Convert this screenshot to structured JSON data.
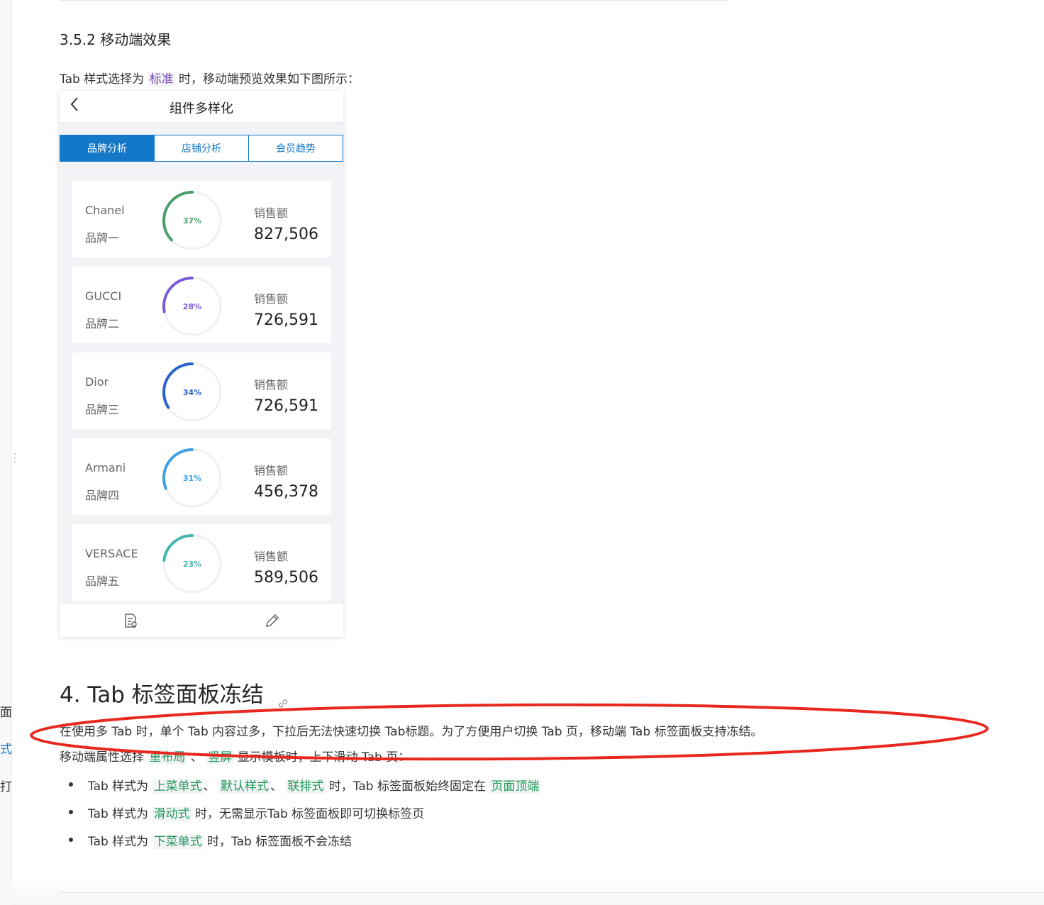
{
  "left_fragments": [
    "面",
    "式",
    "打"
  ],
  "section_352": {
    "title": "3.5.2 移动端效果"
  },
  "intro": {
    "prefix": "Tab 样式选择为 ",
    "tag": "标准",
    "suffix": " 时，移动端预览效果如下图所示："
  },
  "phone": {
    "back_icon": "chevron-left-icon",
    "title": "组件多样化",
    "tabs": [
      {
        "label": "品牌分析",
        "active": true
      },
      {
        "label": "店铺分析",
        "active": false
      },
      {
        "label": "会员趋势",
        "active": false
      }
    ],
    "cards": [
      {
        "brand": "Chanel",
        "name": "品牌一",
        "percent": 37,
        "percent_label": "37%",
        "color": "#4a9f6a",
        "sales_label": "销售额",
        "sales": "827,506"
      },
      {
        "brand": "GUCCI",
        "name": "品牌二",
        "percent": 28,
        "percent_label": "28%",
        "color": "#7a5bd6",
        "sales_label": "销售额",
        "sales": "726,591"
      },
      {
        "brand": "Dior",
        "name": "品牌三",
        "percent": 34,
        "percent_label": "34%",
        "color": "#2a62c9",
        "sales_label": "销售额",
        "sales": "726,591"
      },
      {
        "brand": "Armani",
        "name": "品牌四",
        "percent": 31,
        "percent_label": "31%",
        "color": "#3ea0e4",
        "sales_label": "销售额",
        "sales": "456,378"
      },
      {
        "brand": "VERSACE",
        "name": "品牌五",
        "percent": 23,
        "percent_label": "23%",
        "color": "#45b5ad",
        "sales_label": "销售额",
        "sales": "589,506"
      }
    ],
    "footer_icons": [
      "report-icon",
      "edit-icon"
    ]
  },
  "section_4": {
    "title": "4. Tab 标签面板冻结",
    "para1": "在使用多 Tab 时，单个 Tab 内容过多，下拉后无法快速切换 Tab标题。为了方便用户切换 Tab 页，移动端 Tab 标签面板支持冻结。",
    "para2": {
      "prefix": "移动端属性选择 ",
      "tag1": "重布局",
      "sep": " 、 ",
      "tag2": "竖屏",
      "suffix": " 显示模板时，上下滑动 Tab 页："
    },
    "list": [
      {
        "prefix": "Tab 样式为 ",
        "tags": [
          "上菜单式",
          "默认样式",
          "联排式"
        ],
        "seps": [
          "、 ",
          "、 "
        ],
        "mid": " 时，Tab 标签面板始终固定在 ",
        "tail_tag": "页面顶端",
        "suffix": ""
      },
      {
        "prefix": "Tab 样式为 ",
        "tags": [
          "滑动式"
        ],
        "seps": [],
        "mid": " 时，无需显示Tab 标签面板即可切换标签页",
        "tail_tag": "",
        "suffix": ""
      },
      {
        "prefix": "Tab 样式为 ",
        "tags": [
          "下菜单式"
        ],
        "seps": [],
        "mid": " 时，Tab 标签面板不会冻结",
        "tail_tag": "",
        "suffix": ""
      }
    ]
  },
  "annotation_color": "#e8281e"
}
